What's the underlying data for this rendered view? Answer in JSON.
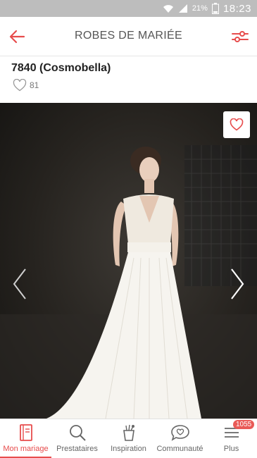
{
  "status_bar": {
    "battery_percent": "21%",
    "time": "18:23",
    "icons": [
      "wifi-icon",
      "signal-icon",
      "battery-icon"
    ]
  },
  "header": {
    "title": "ROBES DE MARIÉE",
    "back_icon": "arrow-left-icon",
    "filter_icon": "sliders-icon",
    "accent": "#e74c4c"
  },
  "product": {
    "title": "7840 (Cosmobella)",
    "likes": "81"
  },
  "gallery": {
    "favorite_icon": "heart-outline-icon",
    "prev_icon": "chevron-left-icon",
    "next_icon": "chevron-right-icon"
  },
  "nav": {
    "items": [
      {
        "label": "Mon mariage",
        "icon": "notebook-icon",
        "active": true
      },
      {
        "label": "Prestataires",
        "icon": "search-icon"
      },
      {
        "label": "Inspiration",
        "icon": "inspiration-icon"
      },
      {
        "label": "Communauté",
        "icon": "chat-heart-icon"
      },
      {
        "label": "Plus",
        "icon": "menu-icon",
        "badge": "1055"
      }
    ]
  }
}
